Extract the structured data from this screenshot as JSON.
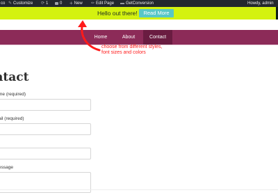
{
  "admin_bar": {
    "site_name": "co",
    "customize": "Customize",
    "updates_count": "1",
    "comments_count": "0",
    "new": "New",
    "edit_page": "Edit Page",
    "getconversion": "GetConversion",
    "howdy": "Howdy, admin"
  },
  "hello_bar": {
    "message": "Hello out there!",
    "button_label": "Read More",
    "background": "#d4f20f",
    "button_color": "#58c7c7"
  },
  "nav": {
    "items": [
      {
        "label": "Home"
      },
      {
        "label": "About"
      },
      {
        "label": "Contact"
      }
    ],
    "background": "#8c2b58",
    "active_background": "#6a1c41"
  },
  "annotation": {
    "text": "choose from different styles, font sizes and colors",
    "color": "#ff1a1a"
  },
  "content": {
    "title": "ntact",
    "fields": [
      {
        "label": "me (required)",
        "value": ""
      },
      {
        "label": "ail (required)",
        "value": ""
      },
      {
        "label": "",
        "value": ""
      },
      {
        "label": "essage",
        "value": ""
      }
    ]
  }
}
